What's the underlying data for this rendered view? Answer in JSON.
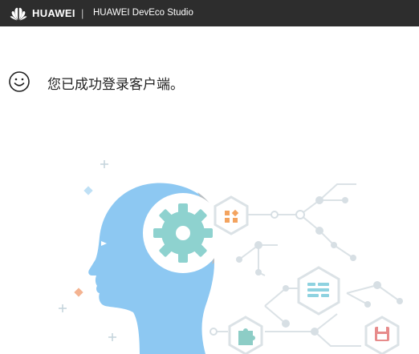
{
  "header": {
    "brand": "HUAWEI",
    "separator": "|",
    "product": "HUAWEI DevEco Studio"
  },
  "message": {
    "icon": "smiley-icon",
    "text": "您已成功登录客户端。"
  },
  "colors": {
    "topbar": "#2d2d2d",
    "head": "#8dc8f2",
    "gear": "#8ed2cf",
    "network": "#d7dfe4",
    "orange": "#f3a35f",
    "red": "#e78b8b",
    "green": "#8dcdc6"
  },
  "illustration": {
    "icons": [
      "head-silhouette",
      "gear-icon",
      "grid-icon",
      "list-icon",
      "puzzle-icon",
      "save-icon"
    ]
  }
}
